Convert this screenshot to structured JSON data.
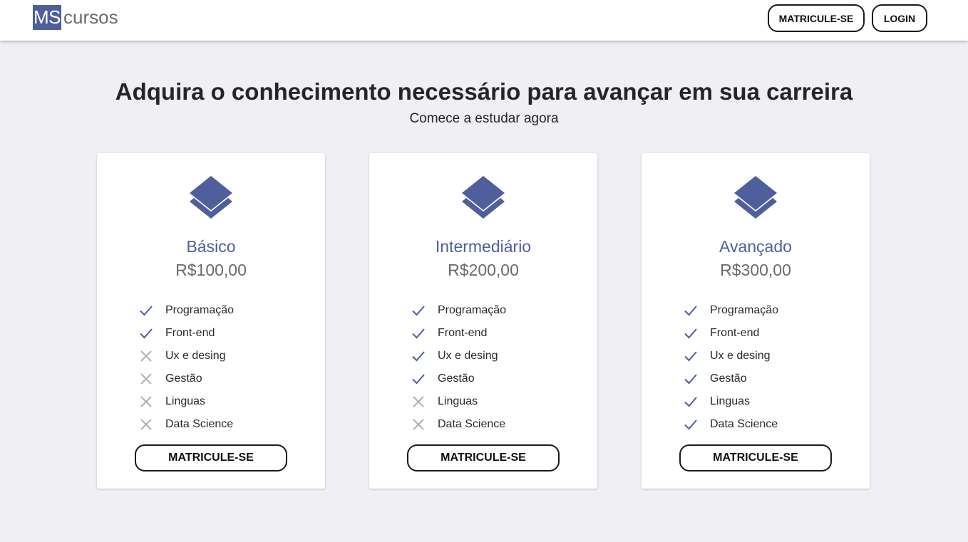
{
  "header": {
    "logo_mark": "MS",
    "logo_text": "cursos",
    "enroll_label": "MATRICULE-SE",
    "login_label": "LOGIN"
  },
  "hero": {
    "title": "Adquira o conhecimento necessário para avançar em sua carreira",
    "subtitle": "Comece a estudar agora"
  },
  "colors": {
    "accent": "#4f5f9c",
    "check": "#4f5f9c",
    "cross": "#b0b0b0",
    "background": "#efeff4"
  },
  "plans": [
    {
      "icon": "layers-icon",
      "name": "Básico",
      "price": "R$100,00",
      "button_label": "MATRICULE-SE",
      "features": [
        {
          "label": "Programação",
          "included": true
        },
        {
          "label": "Front-end",
          "included": true
        },
        {
          "label": "Ux e desing",
          "included": false
        },
        {
          "label": "Gestão",
          "included": false
        },
        {
          "label": "Linguas",
          "included": false
        },
        {
          "label": "Data Science",
          "included": false
        }
      ]
    },
    {
      "icon": "layers-icon",
      "name": "Intermediário",
      "price": "R$200,00",
      "button_label": "MATRICULE-SE",
      "features": [
        {
          "label": "Programação",
          "included": true
        },
        {
          "label": "Front-end",
          "included": true
        },
        {
          "label": "Ux e desing",
          "included": true
        },
        {
          "label": "Gestão",
          "included": true
        },
        {
          "label": "Linguas",
          "included": false
        },
        {
          "label": "Data Science",
          "included": false
        }
      ]
    },
    {
      "icon": "layers-icon",
      "name": "Avançado",
      "price": "R$300,00",
      "button_label": "MATRICULE-SE",
      "features": [
        {
          "label": "Programação",
          "included": true
        },
        {
          "label": "Front-end",
          "included": true
        },
        {
          "label": "Ux e desing",
          "included": true
        },
        {
          "label": "Gestão",
          "included": true
        },
        {
          "label": "Linguas",
          "included": true
        },
        {
          "label": "Data Science",
          "included": true
        }
      ]
    }
  ]
}
